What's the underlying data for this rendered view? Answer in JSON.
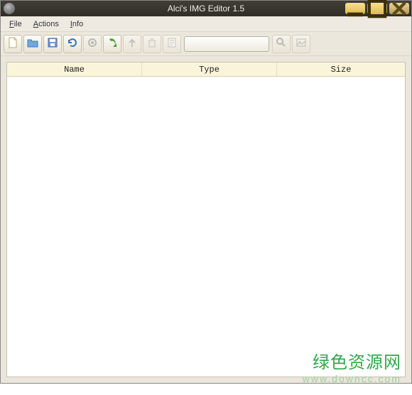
{
  "window": {
    "title": "Alci's IMG Editor 1.5"
  },
  "menu": {
    "file": "File",
    "actions": "Actions",
    "info": "Info"
  },
  "toolbar": {
    "new": "New",
    "open": "Open",
    "save": "Save",
    "refresh": "Refresh",
    "settings": "Settings",
    "import": "Import",
    "export": "Export",
    "delete": "Delete",
    "rename": "Rename",
    "search_placeholder": "",
    "search": "Search",
    "view": "View"
  },
  "table": {
    "headers": {
      "name": "Name",
      "type": "Type",
      "size": "Size"
    },
    "rows": []
  },
  "watermark": {
    "line1": "绿色资源网",
    "line2": "www.downcc.com"
  }
}
